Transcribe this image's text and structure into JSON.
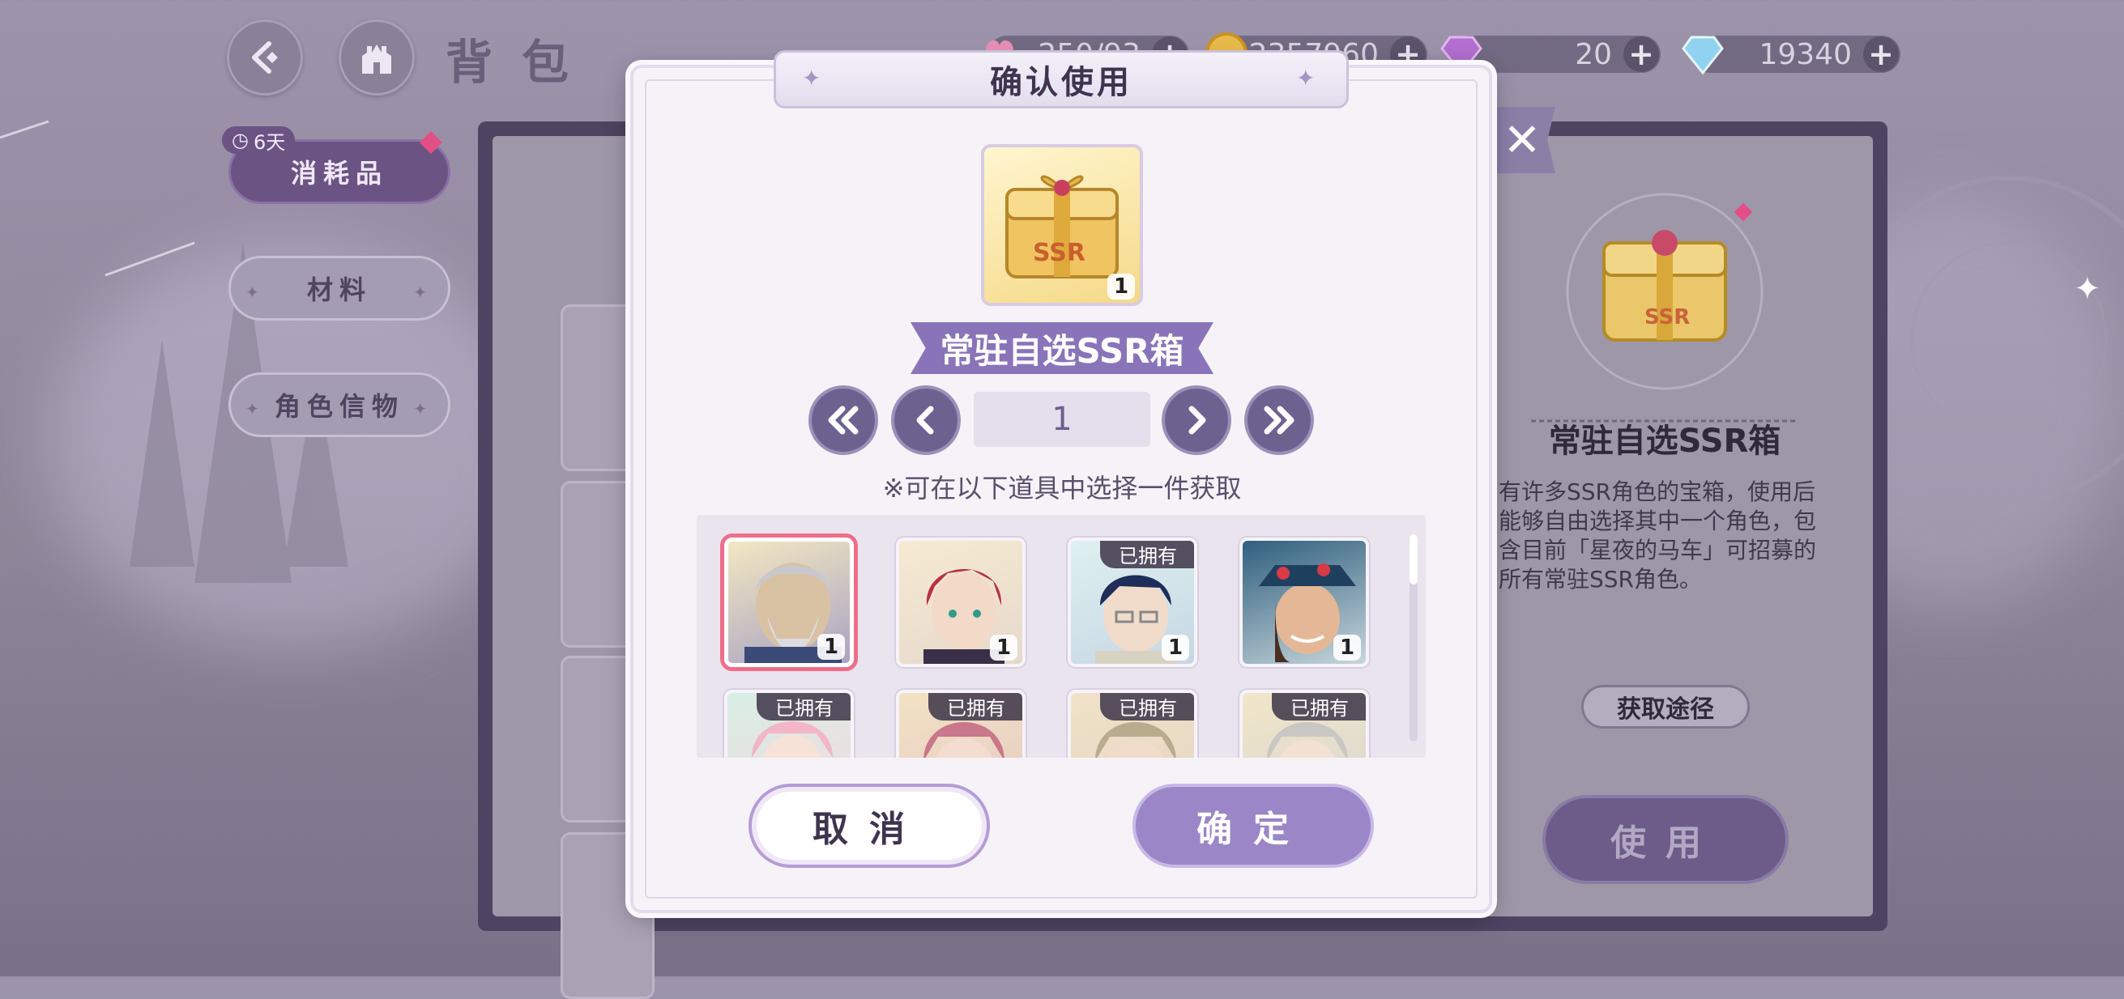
{
  "header": {
    "title": "背包",
    "currencies": [
      {
        "name": "stamina",
        "value": "250/93",
        "icon": "stamina-icon"
      },
      {
        "name": "gold",
        "value": "2357960",
        "icon": "gold-coin-icon"
      },
      {
        "name": "purple-gem",
        "value": "20",
        "icon": "purple-gem-icon"
      },
      {
        "name": "blue-diamond",
        "value": "19340",
        "icon": "blue-diamond-icon"
      }
    ],
    "plus": "+"
  },
  "sidebar": {
    "timer_badge": "6天",
    "tabs": [
      {
        "label": "消耗品",
        "active": true
      },
      {
        "label": "材料",
        "active": false
      },
      {
        "label": "角色信物",
        "active": false
      }
    ]
  },
  "dialog": {
    "title": "确认使用",
    "item_name": "常驻自选SSR箱",
    "item_count": "1",
    "quantity": "1",
    "hint": "※可在以下道具中选择一件获取",
    "choices": [
      {
        "name": "char-1",
        "count": "1",
        "owned": false,
        "selected": true
      },
      {
        "name": "char-2",
        "count": "1",
        "owned": false,
        "selected": false
      },
      {
        "name": "char-3",
        "count": "1",
        "owned": true,
        "selected": false
      },
      {
        "name": "char-4",
        "count": "1",
        "owned": false,
        "selected": false
      },
      {
        "name": "char-5",
        "owned": true
      },
      {
        "name": "char-6",
        "owned": true
      },
      {
        "name": "char-7",
        "owned": true
      },
      {
        "name": "char-8",
        "owned": true
      }
    ],
    "owned_label": "已拥有",
    "cancel_label": "取消",
    "confirm_label": "确定"
  },
  "detail": {
    "title": "常驻自选SSR箱",
    "description": "有许多SSR角色的宝箱，使用后能够自由选择其中一个角色，包含目前「星夜的马车」可招募的所有常驻SSR角色。",
    "source_label": "获取途径",
    "use_label": "使用"
  },
  "colors": {
    "accent_purple": "#8a74b9",
    "selected_border": "#ee6e8a",
    "confirm_button": "#9b86c8"
  }
}
